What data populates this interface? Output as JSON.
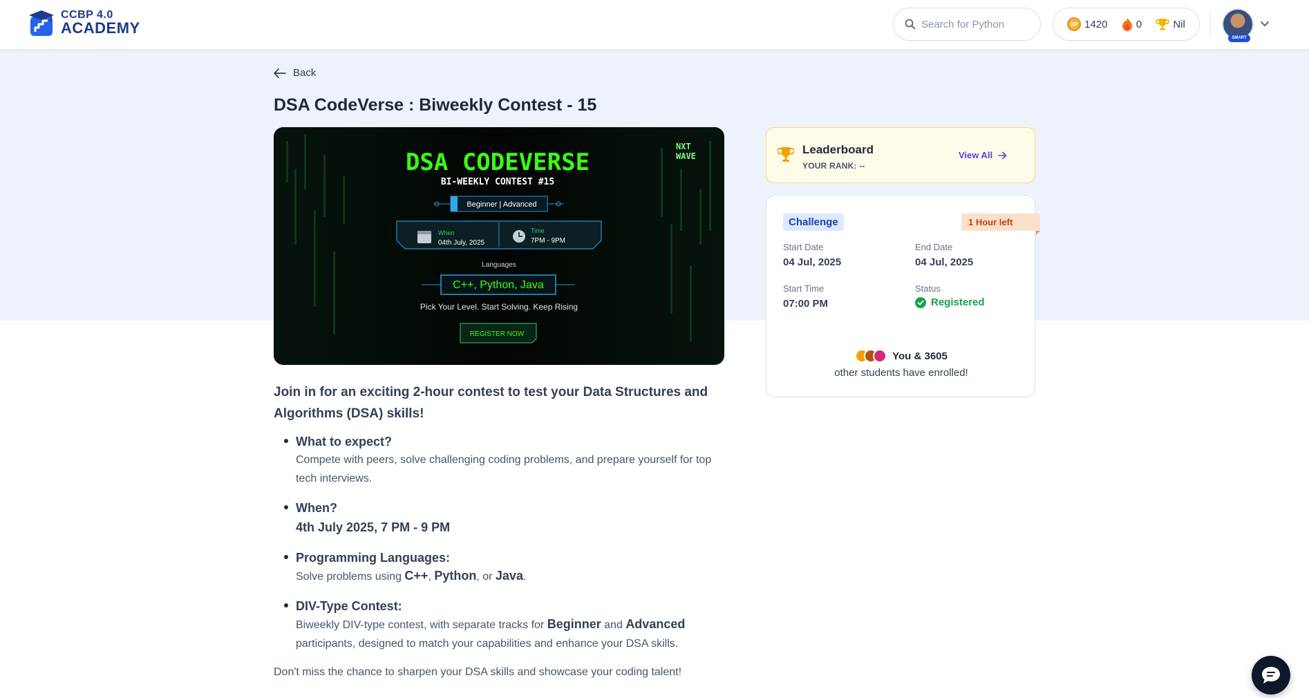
{
  "header": {
    "logo_line1": "CCBP 4.0",
    "logo_line2": "ACADEMY",
    "search_placeholder": "Search for Python",
    "xp_label": "XP",
    "xp": "1420",
    "streak": "0",
    "rank": "Nil",
    "avatar_badge": "SMART"
  },
  "page": {
    "back_label": "Back",
    "title": "DSA CodeVerse : Biweekly Contest - 15"
  },
  "banner": {
    "brand": [
      "NXT",
      "WAVE"
    ],
    "heading": "DSA CODEVERSE",
    "subheading": "BI-WEEKLY CONTEST #15",
    "level": "Beginner | Advanced",
    "when_label": "When",
    "when_value": "04th July, 2025",
    "time_label": "Time",
    "time_value": "7PM - 9PM",
    "languages_label": "Languages",
    "languages": "C++, Python, Java",
    "tagline": "Pick Your Level. Start Solving. Keep Rising",
    "cta": "REGISTER NOW"
  },
  "description": {
    "intro": "Join in for an exciting 2-hour contest to test your Data Structures and Algorithms (DSA) skills!",
    "expect_head": "What to expect?",
    "expect_body": "Compete with peers, solve challenging coding problems, and prepare yourself for top tech interviews.",
    "when_head": "When?",
    "when_body": "4th July 2025, 7 PM - 9 PM",
    "lang_head": "Programming Languages:",
    "lang_pre": "Solve problems using ",
    "lang1": "C++",
    "lang_sep1": ", ",
    "lang2": "Python",
    "lang_sep2": ", or ",
    "lang3": "Java",
    "lang_end": ".",
    "div_head": "DIV-Type Contest:",
    "div_pre": "Biweekly DIV-type contest, with separate tracks for ",
    "div_b1": "Beginner",
    "div_mid": " and ",
    "div_b2": "Advanced",
    "div_post": " participants, designed to match your capabilities and enhance your DSA skills.",
    "closing": "Don't miss the chance to sharpen your DSA skills and showcase your coding talent!"
  },
  "leaderboard": {
    "title": "Leaderboard",
    "rank": "YOUR RANK: --",
    "view_all": "View All"
  },
  "challenge": {
    "chip": "Challenge",
    "time_left": "1 Hour left",
    "start_date_label": "Start Date",
    "start_date": "04 Jul, 2025",
    "end_date_label": "End Date",
    "end_date": "04 Jul, 2025",
    "start_time_label": "Start Time",
    "start_time": "07:00 PM",
    "status_label": "Status",
    "status": "Registered",
    "enrolled_main": "You & 3605",
    "enrolled_sub": "other students have enrolled!"
  },
  "colors": {
    "accent": "#4f46e5",
    "status_green": "#16a34a",
    "banner_green": "#39ff14",
    "band_bg": "#eef2fc"
  }
}
